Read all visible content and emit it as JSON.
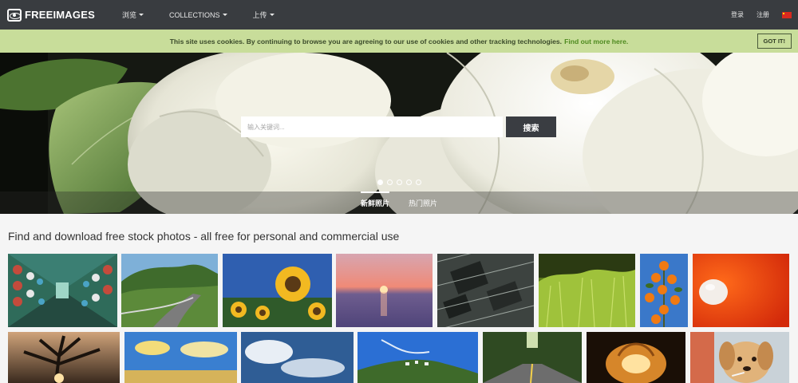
{
  "navbar": {
    "logo_text": "FREEIMAGES",
    "links": [
      {
        "label": "浏览"
      },
      {
        "label": "COLLECTIONS"
      },
      {
        "label": "上传"
      }
    ],
    "login": "登录",
    "register": "注册",
    "flag_icon": "china-flag-icon"
  },
  "cookie": {
    "text": "This site uses cookies. By continuing to browse you are agreeing to our use of cookies and other tracking technologies.",
    "link": "Find out more here.",
    "button": "GOT IT!"
  },
  "hero": {
    "search_placeholder": "输入关键词...",
    "search_button": "搜索",
    "slides": 5,
    "active_slide": 1,
    "tabs": [
      {
        "label": "新鲜照片",
        "active": true
      },
      {
        "label": "热门照片",
        "active": false
      }
    ]
  },
  "main": {
    "heading": "Find and download free stock photos - all free for personal and commercial use"
  },
  "colors": {
    "navbar": "#393c40",
    "cookie_bar": "#c8dd9a",
    "cookie_link": "#4e8a1f",
    "search_button": "#3a3d42"
  }
}
